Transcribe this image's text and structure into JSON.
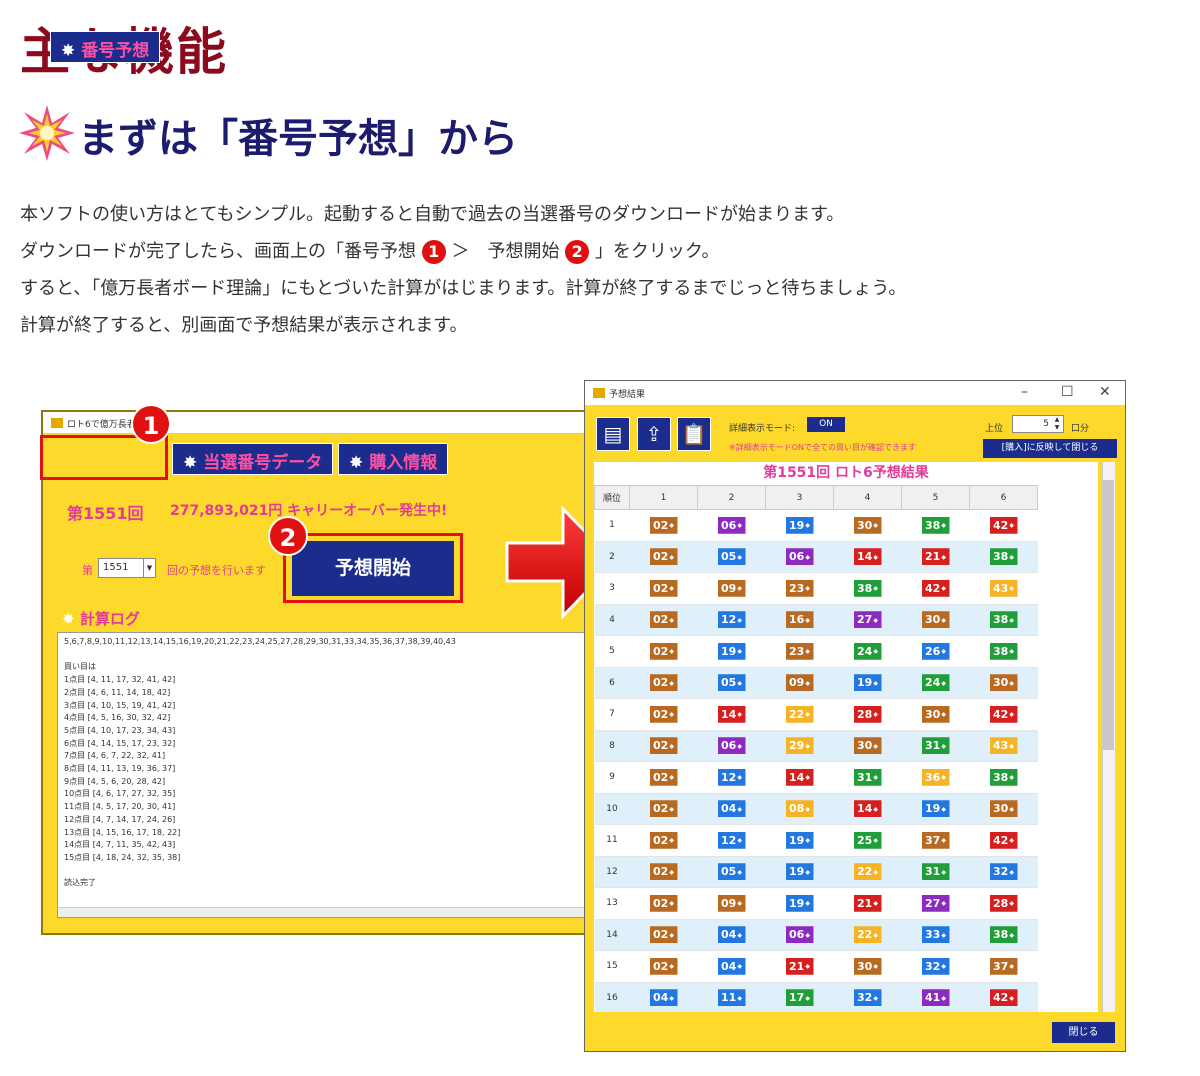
{
  "heading": "主な機能",
  "subheading": "まずは「番号予想」から",
  "intro": {
    "line1": "本ソフトの使い方はとてもシンプル。起動すると自動で過去の当選番号のダウンロードが始まります。",
    "line2_a": "ダウンロードが完了したら、画面上の「番号予想",
    "line2_b": "＞　予想開始",
    "line2_c": "」をクリック。",
    "badge1": "1",
    "badge2": "2",
    "line3": "すると、「億万長者ボード理論」にもとづいた計算がはじまります。計算が終了するまでじっと待ちましょう。",
    "line4": "計算が終了すると、別画面で予想結果が表示されます。"
  },
  "left_window": {
    "title": "ロト6で億万長者",
    "tabs": [
      "番号予想",
      "当選番号データ",
      "購入情報"
    ],
    "tab_star": "✸",
    "round": "第1551回",
    "carryover": "277,893,021円 キャリーオーバー発生中!",
    "round_prefix": "第",
    "round_select": "1551",
    "round_suffix": "回の予想を行います",
    "start_button": "予想開始",
    "log_title": "計算ログ",
    "callout1": "1",
    "callout2": "2",
    "log_text": "5,6,7,8,9,10,11,12,13,14,15,16,19,20,21,22,23,24,25,27,28,29,30,31,33,34,35,36,37,38,39,40,43\n\n買い目は\n1点目 [4, 11, 17, 32, 41, 42]\n2点目 [4, 6, 11, 14, 18, 42]\n3点目 [4, 10, 15, 19, 41, 42]\n4点目 [4, 5, 16, 30, 32, 42]\n5点目 [4, 10, 17, 23, 34, 43]\n6点目 [4, 14, 15, 17, 23, 32]\n7点目 [4, 6, 7, 22, 32, 41]\n8点目 [4, 11, 13, 19, 36, 37]\n9点目 [4, 5, 6, 20, 28, 42]\n10点目 [4, 6, 17, 27, 32, 35]\n11点目 [4, 5, 17, 20, 30, 41]\n12点目 [4, 7, 14, 17, 24, 26]\n13点目 [4, 15, 16, 17, 18, 22]\n14点目 [4, 7, 11, 35, 42, 43]\n15点目 [4, 18, 24, 32, 35, 38]\n\n読込完了"
  },
  "right_window": {
    "title": "予想結果",
    "controls": [
      "–",
      "☐",
      "✕"
    ],
    "detail_label": "詳細表示モード:",
    "detail_value": "ON",
    "note": "※詳細表示モードONで全ての買い目が確認できます",
    "top_label": "上位",
    "top_value": "5",
    "top_suffix": "口分",
    "reflect_button": "[購入]に反映して閉じる",
    "grid_title": "第1551回 ロト6予想結果",
    "columns": [
      "順位",
      "1",
      "2",
      "3",
      "4",
      "5",
      "6"
    ],
    "rows": [
      [
        "1",
        "02",
        "06",
        "19",
        "30",
        "38",
        "42"
      ],
      [
        "2",
        "02",
        "05",
        "06",
        "14",
        "21",
        "38"
      ],
      [
        "3",
        "02",
        "09",
        "23",
        "38",
        "42",
        "43"
      ],
      [
        "4",
        "02",
        "12",
        "16",
        "27",
        "30",
        "38"
      ],
      [
        "5",
        "02",
        "19",
        "23",
        "24",
        "26",
        "38"
      ],
      [
        "6",
        "02",
        "05",
        "09",
        "19",
        "24",
        "30"
      ],
      [
        "7",
        "02",
        "14",
        "22",
        "28",
        "30",
        "42"
      ],
      [
        "8",
        "02",
        "06",
        "29",
        "30",
        "31",
        "43"
      ],
      [
        "9",
        "02",
        "12",
        "14",
        "31",
        "36",
        "38"
      ],
      [
        "10",
        "02",
        "04",
        "08",
        "14",
        "19",
        "30"
      ],
      [
        "11",
        "02",
        "12",
        "19",
        "25",
        "37",
        "42"
      ],
      [
        "12",
        "02",
        "05",
        "19",
        "22",
        "31",
        "32"
      ],
      [
        "13",
        "02",
        "09",
        "19",
        "21",
        "27",
        "28"
      ],
      [
        "14",
        "02",
        "04",
        "06",
        "22",
        "33",
        "38"
      ],
      [
        "15",
        "02",
        "04",
        "21",
        "30",
        "32",
        "37"
      ],
      [
        "16",
        "04",
        "11",
        "17",
        "32",
        "41",
        "42"
      ]
    ],
    "close_button": "閉じる"
  },
  "colors": {
    "heading": "#8b0a1d",
    "subheading": "#1c1c6e",
    "window_bg": "#fcd92a",
    "navy": "#1c2c8c",
    "pink": "#e23c9a",
    "red": "#e21111",
    "number_colors": {
      "02": "#b86a22",
      "04": "#2277e0",
      "05": "#2277e0",
      "06": "#8e2bbf",
      "08": "#f5b325",
      "09": "#b86a22",
      "11": "#2277e0",
      "12": "#2277e0",
      "14": "#d61f1f",
      "16": "#b86a22",
      "17": "#1f9e3a",
      "19": "#2277e0",
      "21": "#d61f1f",
      "22": "#f5b325",
      "23": "#b86a22",
      "24": "#1f9e3a",
      "25": "#1f9e3a",
      "26": "#2277e0",
      "27": "#8e2bbf",
      "28": "#d61f1f",
      "29": "#f5b325",
      "30": "#b86a22",
      "31": "#1f9e3a",
      "32": "#2277e0",
      "33": "#2277e0",
      "36": "#f5b325",
      "37": "#b86a22",
      "38": "#1f9e3a",
      "41": "#8e2bbf",
      "42": "#d61f1f",
      "43": "#f5b325"
    }
  }
}
